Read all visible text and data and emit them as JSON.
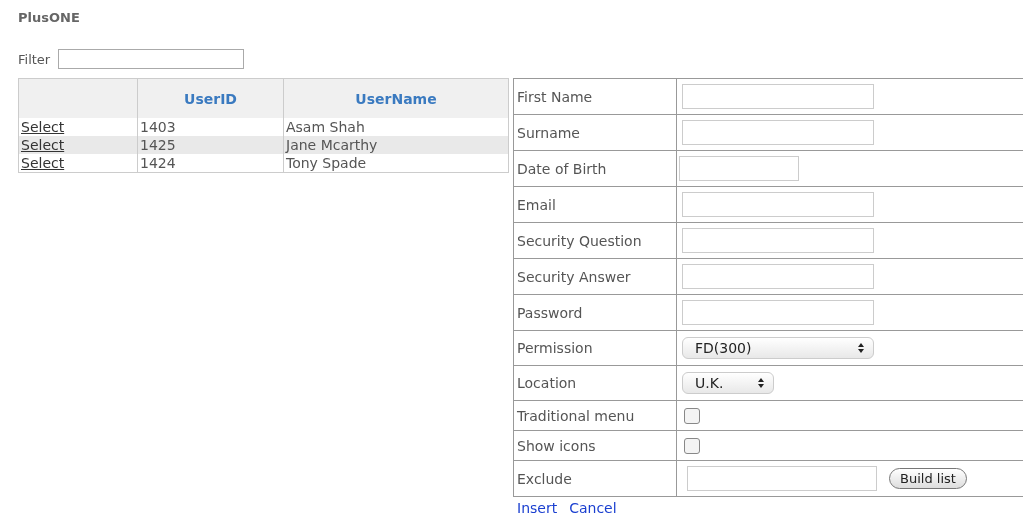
{
  "app_title": "PlusONE",
  "filter": {
    "label": "Filter"
  },
  "users": {
    "columns": [
      null,
      "UserID",
      "UserName"
    ],
    "rows": [
      {
        "action": "Select",
        "id": "1403",
        "name": "Asam Shah"
      },
      {
        "action": "Select",
        "id": "1425",
        "name": "Jane Mcarthy"
      },
      {
        "action": "Select",
        "id": "1424",
        "name": "Tony Spade"
      }
    ]
  },
  "form": [
    {
      "kind": "text",
      "label": "First Name"
    },
    {
      "kind": "text",
      "label": "Surname"
    },
    {
      "kind": "date",
      "label": "Date of Birth"
    },
    {
      "kind": "text",
      "label": "Email"
    },
    {
      "kind": "text",
      "label": "Security Question"
    },
    {
      "kind": "text",
      "label": "Security Answer"
    },
    {
      "kind": "text",
      "label": "Password"
    },
    {
      "kind": "select",
      "label": "Permission",
      "value": "FD(300)",
      "wide": true
    },
    {
      "kind": "select",
      "label": "Location",
      "value": "U.K.",
      "wide": false
    },
    {
      "kind": "checkbox",
      "label": "Traditional menu",
      "checked": false
    },
    {
      "kind": "checkbox",
      "label": "Show icons",
      "checked": false
    },
    {
      "kind": "exclude",
      "label": "Exclude",
      "button": "Build list"
    }
  ],
  "links": [
    "Insert",
    "Cancel"
  ]
}
